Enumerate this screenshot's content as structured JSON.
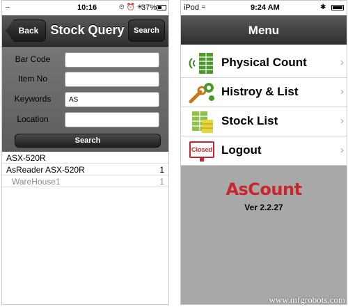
{
  "left_phone": {
    "status": {
      "signal": "∙∙∙∙",
      "time": "10:16",
      "status_icons": "⏲ ⏰ ✳",
      "battery": "37%"
    },
    "nav": {
      "back_label": "Back",
      "title": "Stock Query",
      "search_label": "Search"
    },
    "form": {
      "fields": [
        {
          "label": "Bar Code",
          "value": ""
        },
        {
          "label": "Item No",
          "value": ""
        },
        {
          "label": "Keywords",
          "value": "AS"
        },
        {
          "label": "Location",
          "value": ""
        }
      ],
      "search_button": "Search"
    },
    "results": [
      {
        "text": "ASX-520R",
        "count": ""
      },
      {
        "text": "AsReader ASX-520R",
        "count": "1"
      },
      {
        "text": "WareHouse1",
        "count": "1"
      }
    ]
  },
  "right_phone": {
    "status": {
      "carrier": "iPod",
      "time": "9:24 AM",
      "bluetooth": "✱"
    },
    "nav": {
      "title": "Menu"
    },
    "menu": [
      {
        "label": "Physical Count",
        "icon": "physical-count-icon"
      },
      {
        "label": "Histroy & List",
        "icon": "history-list-icon"
      },
      {
        "label": "Stock List",
        "icon": "stock-list-icon"
      },
      {
        "label": "Logout",
        "icon": "logout-icon",
        "icon_text": "Closed"
      }
    ],
    "chevron": "›",
    "logo": "AsCount",
    "version": "Ver 2.2.27"
  },
  "watermark": "www.mfgrobots.com",
  "colors": {
    "nav_dark": "#2d2d2d",
    "panel_gray": "#6a6a6a",
    "logo_red": "#c9252c",
    "lower_gray": "#a8a8a8",
    "icon_green": "#4c9a2a"
  }
}
